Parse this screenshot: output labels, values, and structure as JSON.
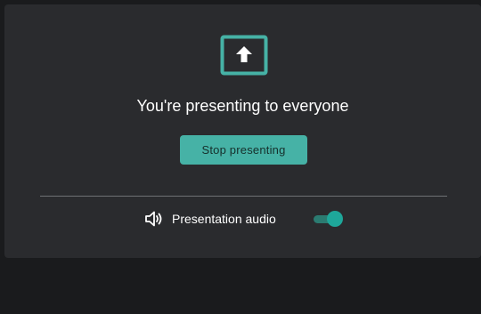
{
  "presenting": {
    "icon": "present-to-all-icon",
    "title": "You're presenting to everyone",
    "stop_label": "Stop presenting"
  },
  "audio": {
    "icon": "speaker-icon",
    "label": "Presentation audio",
    "toggle_on": true
  },
  "colors": {
    "accent": "#46b2a6",
    "card_bg": "#2a2b2e",
    "page_bg": "#1a1b1d",
    "toggle_on": "#1ea79a"
  }
}
